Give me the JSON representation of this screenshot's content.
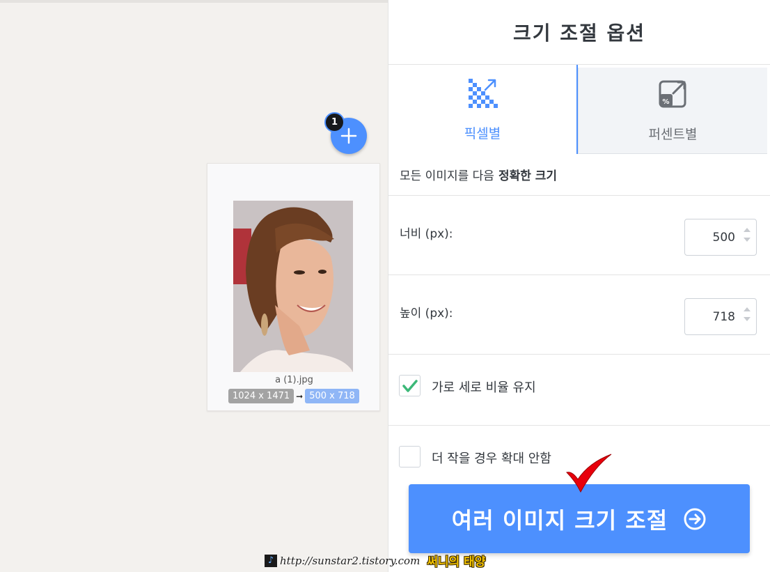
{
  "panel": {
    "title": "크기 조절 옵션",
    "tabs": [
      {
        "label": "픽셀별",
        "icon": "pixel-resize-icon",
        "active": true
      },
      {
        "label": "퍼센트별",
        "icon": "percent-resize-icon",
        "active": false
      }
    ],
    "description_prefix": "모든 이미지를 다음",
    "description_bold": "정확한 크기",
    "width": {
      "label": "너비 (px):",
      "value": "500"
    },
    "height": {
      "label": "높이 (px):",
      "value": "718"
    },
    "keep_ratio": {
      "label": "가로 세로 비율 유지",
      "checked": true
    },
    "no_enlarge": {
      "label": "더 작을 경우 확대 안함",
      "checked": false
    },
    "submit_label": "여러 이미지 크기 조절"
  },
  "workspace": {
    "file_count": "1",
    "file": {
      "name": "a (1).jpg",
      "original_size": "1024 x 1471",
      "new_size": "500 x 718"
    }
  },
  "watermark": {
    "url": "http://sunstar2.tistory.com",
    "sign": "써니의 태양"
  },
  "colors": {
    "accent": "#4d90fe",
    "check": "#3cb878",
    "annotation": "#e8000b"
  }
}
